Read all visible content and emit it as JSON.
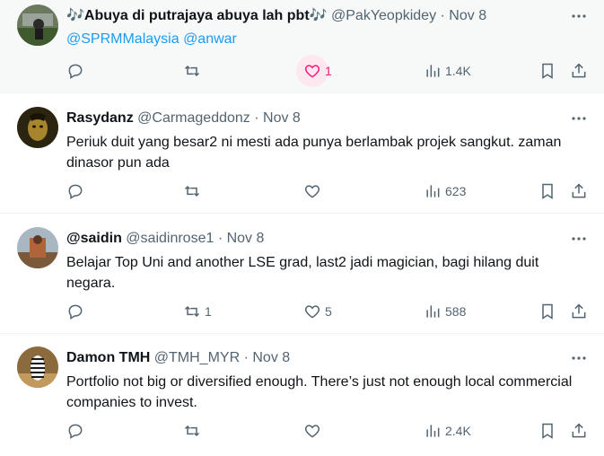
{
  "tweets": [
    {
      "name": "🎶Abuya di putrajaya abuya lah pbt🎶",
      "handle": "@PakYeopkidey",
      "date": "· Nov 8",
      "text_mention1": "@SPRMMalaysia",
      "text_mention2": "@anwar",
      "replies": "",
      "retweets": "",
      "likes": "1",
      "views": "1.4K",
      "liked": true
    },
    {
      "name": "Rasydanz",
      "handle": "@Carmageddonz",
      "date": "· Nov 8",
      "text": "Periuk duit yang besar2 ni mesti ada punya berlambak projek sangkut. zaman dinasor pun ada",
      "replies": "",
      "retweets": "",
      "likes": "",
      "views": "623"
    },
    {
      "name": "@saidin",
      "handle": "@saidinrose1",
      "date": "· Nov 8",
      "text": "Belajar Top Uni and another LSE grad, last2 jadi magician, bagi hilang duit negara.",
      "replies": "",
      "retweets": "1",
      "likes": "5",
      "views": "588"
    },
    {
      "name": "Damon TMH",
      "handle": "@TMH_MYR",
      "date": "· Nov 8",
      "text": "Portfolio not big or diversified enough. There’s just not enough local commercial companies to invest.",
      "replies": "",
      "retweets": "",
      "likes": "",
      "views": "2.4K"
    }
  ],
  "colors": {
    "accent": "#1d9bf0",
    "like": "#f91880",
    "muted": "#536471"
  }
}
